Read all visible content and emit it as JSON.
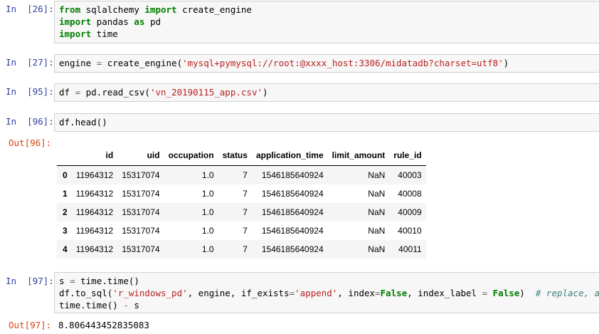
{
  "cells": {
    "c26": {
      "prompt": "In  [26]:",
      "lines": [
        [
          "from",
          " sqlalchemy ",
          "import",
          " create_engine"
        ],
        [
          "import",
          " pandas ",
          "as",
          " pd"
        ],
        [
          "import",
          " time"
        ]
      ]
    },
    "c27": {
      "prompt": "In  [27]:",
      "pre": "engine ",
      "eq": "=",
      "mid": " create_engine(",
      "str": "'mysql+pymysql://root:@xxxx_host:3306/midatadb?charset=utf8'",
      "post": ")"
    },
    "c95": {
      "prompt": "In  [95]:",
      "pre": "df ",
      "eq": "=",
      "mid": " pd.read_csv(",
      "str": "'vn_20190115_app.csv'",
      "post": ")"
    },
    "c96": {
      "prompt": "In  [96]:",
      "code": "df.head()",
      "out_prompt": "Out[96]:"
    },
    "c97": {
      "prompt": "In  [97]:",
      "out_prompt": "Out[97]:",
      "output": "8.806443452835083",
      "l1_a": "s ",
      "l1_eq": "=",
      "l1_b": " time.time()",
      "l2_a": "df.to_sql(",
      "l2_s1": "'r_windows_pd'",
      "l2_b": ", engine, if_exists",
      "l2_eq1": "=",
      "l2_s2": "'append'",
      "l2_c": ", index",
      "l2_eq2": "=",
      "l2_k1": "False",
      "l2_d": ", index_label ",
      "l2_eq3": "=",
      "l2_e": " ",
      "l2_k2": "False",
      "l2_f": ")  ",
      "l2_cmt": "# replace, append",
      "l3_a": "time.time() ",
      "l3_op": "-",
      "l3_b": " s"
    }
  },
  "dataframe": {
    "columns": [
      "",
      "id",
      "uid",
      "occupation",
      "status",
      "application_time",
      "limit_amount",
      "rule_id"
    ],
    "rows": [
      [
        "0",
        "11964312",
        "15317074",
        "1.0",
        "7",
        "1546185640924",
        "NaN",
        "40003"
      ],
      [
        "1",
        "11964312",
        "15317074",
        "1.0",
        "7",
        "1546185640924",
        "NaN",
        "40008"
      ],
      [
        "2",
        "11964312",
        "15317074",
        "1.0",
        "7",
        "1546185640924",
        "NaN",
        "40009"
      ],
      [
        "3",
        "11964312",
        "15317074",
        "1.0",
        "7",
        "1546185640924",
        "NaN",
        "40010"
      ],
      [
        "4",
        "11964312",
        "15317074",
        "1.0",
        "7",
        "1546185640924",
        "NaN",
        "40011"
      ]
    ]
  }
}
